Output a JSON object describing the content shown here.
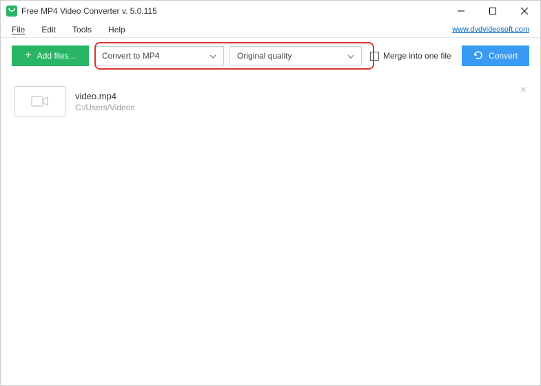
{
  "titlebar": {
    "title": "Free MP4 Video Converter v. 5.0.115"
  },
  "menu": {
    "file": "File",
    "edit": "Edit",
    "tools": "Tools",
    "help": "Help",
    "website": "www.dvdvideosoft.com"
  },
  "toolbar": {
    "add_files": "Add files...",
    "format_dropdown": "Convert to MP4",
    "quality_dropdown": "Original quality",
    "merge_label": "Merge into one file",
    "convert": "Convert"
  },
  "file": {
    "name": "video.mp4",
    "path": "C:/Users/Videos"
  },
  "colors": {
    "green": "#28b565",
    "blue": "#3a9bf4",
    "highlight": "#d9362e",
    "link": "#0067c0"
  }
}
